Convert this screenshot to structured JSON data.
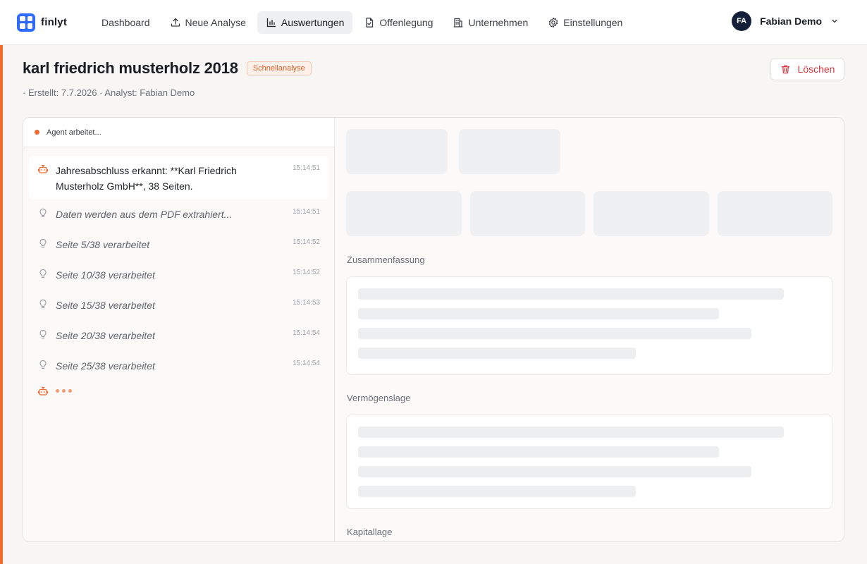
{
  "app": {
    "brand": "finlyt"
  },
  "nav": {
    "items": [
      {
        "label": "Dashboard",
        "icon": "none"
      },
      {
        "label": "Neue Analyse",
        "icon": "upload-icon"
      },
      {
        "label": "Auswertungen",
        "icon": "bar-chart-icon",
        "active": true
      },
      {
        "label": "Offenlegung",
        "icon": "document-check-icon"
      },
      {
        "label": "Unternehmen",
        "icon": "building-icon"
      },
      {
        "label": "Einstellungen",
        "icon": "gear-icon"
      }
    ]
  },
  "user": {
    "initials": "FA",
    "name": "Fabian Demo"
  },
  "header": {
    "title": "karl friedrich musterholz 2018",
    "badge": "Schnellanalyse",
    "meta": "· Erstellt: 7.7.2026 · Analyst: Fabian Demo",
    "delete_label": "Löschen"
  },
  "agent": {
    "status": "Agent arbeitet...",
    "log": [
      {
        "text": "Jahresabschluss erkannt: **Karl Friedrich Musterholz GmbH**, 38 Seiten.",
        "time": "15:14:51",
        "icon": "robot-icon"
      },
      {
        "text": "Daten werden aus dem PDF extrahiert...",
        "time": "15:14:51",
        "icon": "lightbulb-icon"
      },
      {
        "text": "Seite 5/38 verarbeitet",
        "time": "15:14:52",
        "icon": "lightbulb-icon"
      },
      {
        "text": "Seite 10/38 verarbeitet",
        "time": "15:14:52",
        "icon": "lightbulb-icon"
      },
      {
        "text": "Seite 15/38 verarbeitet",
        "time": "15:14:53",
        "icon": "lightbulb-icon"
      },
      {
        "text": "Seite 20/38 verarbeitet",
        "time": "15:14:54",
        "icon": "lightbulb-icon"
      },
      {
        "text": "Seite 25/38 verarbeitet",
        "time": "15:14:54",
        "icon": "lightbulb-icon"
      }
    ]
  },
  "sections": {
    "summary": "Zusammenfassung",
    "assets": "Vermögenslage",
    "capital": "Kapitallage"
  },
  "colors": {
    "accent": "#f26a2e",
    "brand": "#2f6bff",
    "danger": "#d6313b"
  }
}
